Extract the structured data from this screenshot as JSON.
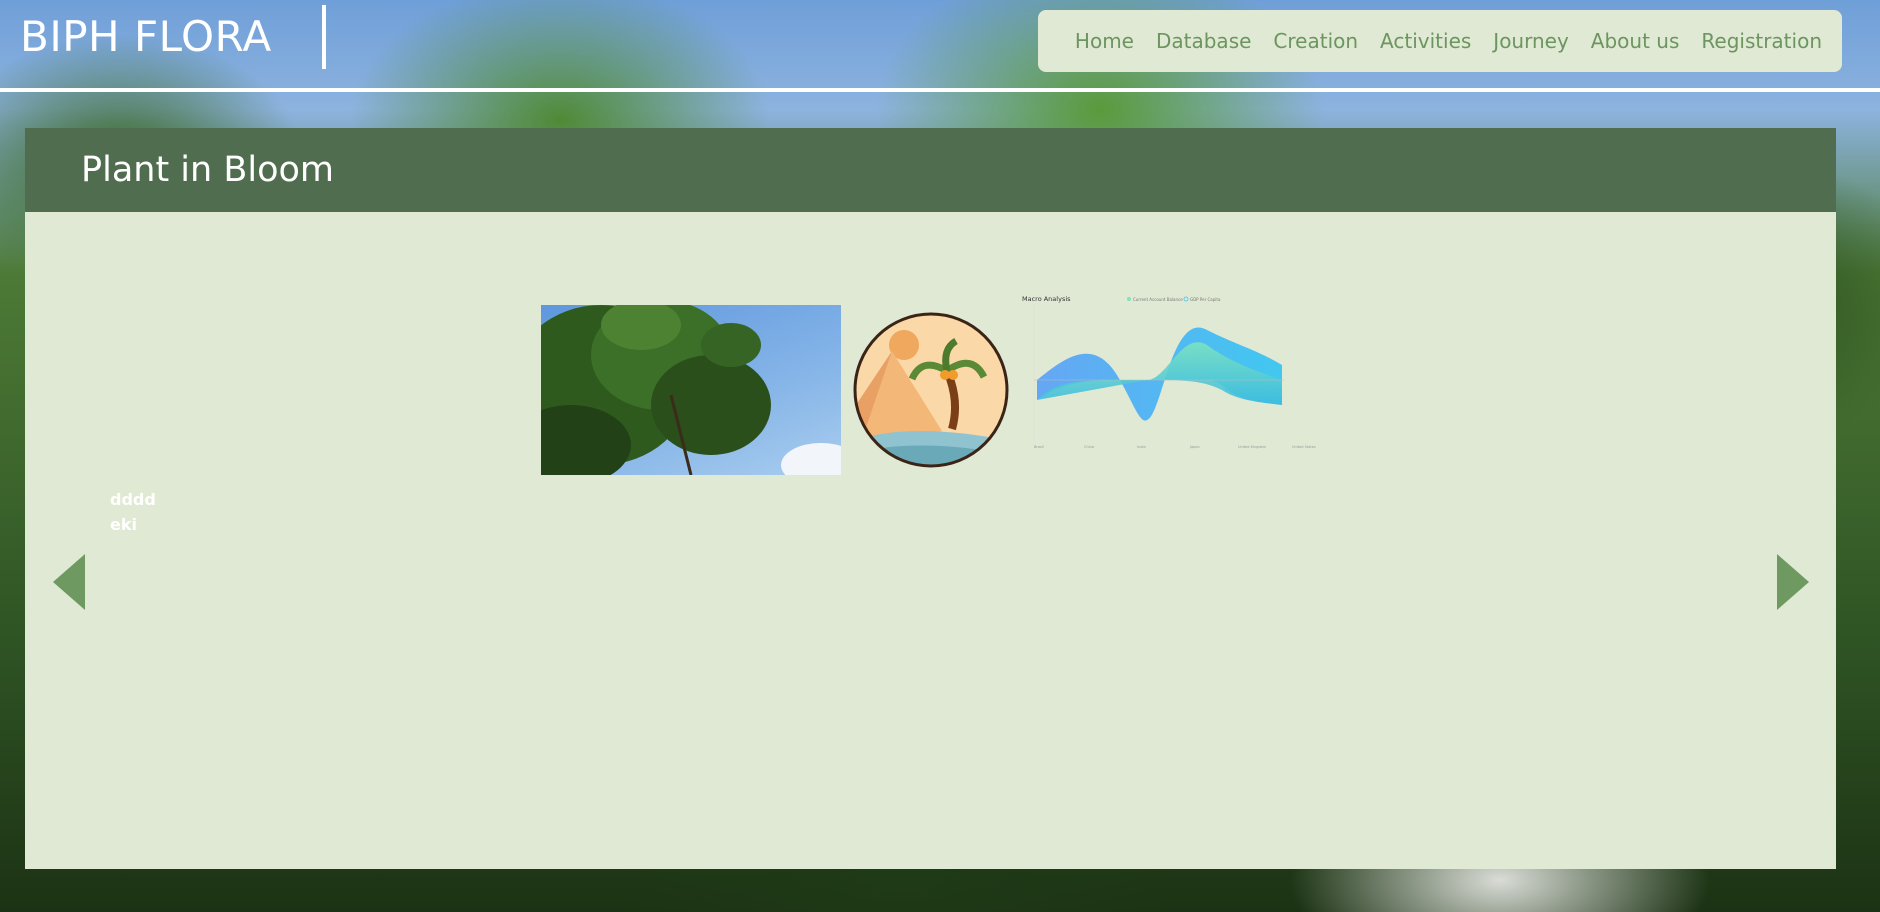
{
  "header": {
    "logo": "BIPH FLORA",
    "nav": [
      "Home",
      "Database",
      "Creation",
      "Activities",
      "Journey",
      "About us",
      "Registration"
    ]
  },
  "panel": {
    "title": "Plant in Bloom",
    "caption_lines": [
      "dddd",
      "eki"
    ]
  },
  "gallery": {
    "items": [
      "tree-photo",
      "palm-beach-illustration",
      "macro-analysis-chart"
    ],
    "chart_thumbnail": {
      "title": "Macro Analysis",
      "legend": [
        "Current Account Balance",
        "GDP Per Capita"
      ],
      "x_labels": [
        "Brazil",
        "China",
        "India",
        "Japan",
        "United Kingdom",
        "United States"
      ]
    }
  },
  "colors": {
    "nav_bg": "#e0e9d3",
    "nav_text": "#6c9560",
    "panel_bg": "#e0e9d4",
    "panel_header": "#506e4f",
    "arrow": "#6e9a62"
  }
}
